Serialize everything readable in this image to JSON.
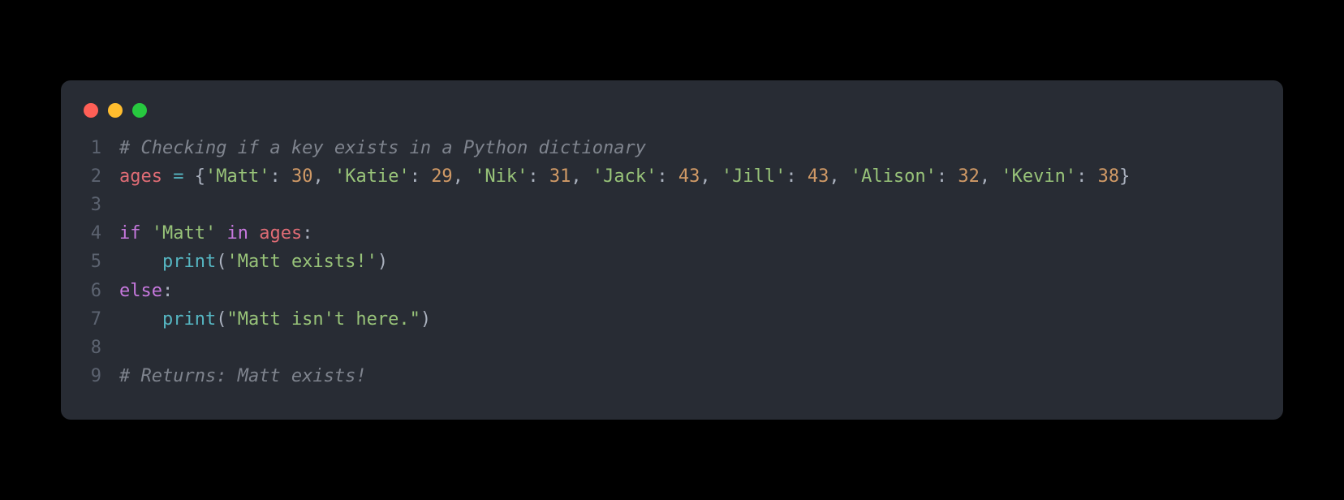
{
  "window": {
    "traffic_lights": [
      "close",
      "minimize",
      "zoom"
    ]
  },
  "code": {
    "lines": [
      {
        "n": "1",
        "tokens": [
          {
            "cls": "tok-comment",
            "t": "# Checking if a key exists in a Python dictionary"
          }
        ]
      },
      {
        "n": "2",
        "tokens": [
          {
            "cls": "tok-ident",
            "t": "ages"
          },
          {
            "cls": "tok-default",
            "t": " "
          },
          {
            "cls": "tok-op",
            "t": "="
          },
          {
            "cls": "tok-default",
            "t": " {"
          },
          {
            "cls": "tok-string",
            "t": "'Matt'"
          },
          {
            "cls": "tok-default",
            "t": ": "
          },
          {
            "cls": "tok-number",
            "t": "30"
          },
          {
            "cls": "tok-default",
            "t": ", "
          },
          {
            "cls": "tok-string",
            "t": "'Katie'"
          },
          {
            "cls": "tok-default",
            "t": ": "
          },
          {
            "cls": "tok-number",
            "t": "29"
          },
          {
            "cls": "tok-default",
            "t": ", "
          },
          {
            "cls": "tok-string",
            "t": "'Nik'"
          },
          {
            "cls": "tok-default",
            "t": ": "
          },
          {
            "cls": "tok-number",
            "t": "31"
          },
          {
            "cls": "tok-default",
            "t": ", "
          },
          {
            "cls": "tok-string",
            "t": "'Jack'"
          },
          {
            "cls": "tok-default",
            "t": ": "
          },
          {
            "cls": "tok-number",
            "t": "43"
          },
          {
            "cls": "tok-default",
            "t": ", "
          },
          {
            "cls": "tok-string",
            "t": "'Jill'"
          },
          {
            "cls": "tok-default",
            "t": ": "
          },
          {
            "cls": "tok-number",
            "t": "43"
          },
          {
            "cls": "tok-default",
            "t": ", "
          },
          {
            "cls": "tok-string",
            "t": "'Alison'"
          },
          {
            "cls": "tok-default",
            "t": ": "
          },
          {
            "cls": "tok-number",
            "t": "32"
          },
          {
            "cls": "tok-default",
            "t": ", "
          },
          {
            "cls": "tok-string",
            "t": "'Kevin'"
          },
          {
            "cls": "tok-default",
            "t": ": "
          },
          {
            "cls": "tok-number",
            "t": "38"
          },
          {
            "cls": "tok-default",
            "t": "}"
          }
        ]
      },
      {
        "n": "3",
        "tokens": []
      },
      {
        "n": "4",
        "tokens": [
          {
            "cls": "tok-keyword",
            "t": "if"
          },
          {
            "cls": "tok-default",
            "t": " "
          },
          {
            "cls": "tok-string",
            "t": "'Matt'"
          },
          {
            "cls": "tok-default",
            "t": " "
          },
          {
            "cls": "tok-keyword",
            "t": "in"
          },
          {
            "cls": "tok-default",
            "t": " "
          },
          {
            "cls": "tok-ident",
            "t": "ages"
          },
          {
            "cls": "tok-default",
            "t": ":"
          }
        ]
      },
      {
        "n": "5",
        "tokens": [
          {
            "cls": "tok-default",
            "t": "    "
          },
          {
            "cls": "tok-builtin",
            "t": "print"
          },
          {
            "cls": "tok-default",
            "t": "("
          },
          {
            "cls": "tok-string",
            "t": "'Matt exists!'"
          },
          {
            "cls": "tok-default",
            "t": ")"
          }
        ]
      },
      {
        "n": "6",
        "tokens": [
          {
            "cls": "tok-keyword",
            "t": "else"
          },
          {
            "cls": "tok-default",
            "t": ":"
          }
        ]
      },
      {
        "n": "7",
        "tokens": [
          {
            "cls": "tok-default",
            "t": "    "
          },
          {
            "cls": "tok-builtin",
            "t": "print"
          },
          {
            "cls": "tok-default",
            "t": "("
          },
          {
            "cls": "tok-string",
            "t": "\"Matt isn't here.\""
          },
          {
            "cls": "tok-default",
            "t": ")"
          }
        ]
      },
      {
        "n": "8",
        "tokens": []
      },
      {
        "n": "9",
        "tokens": [
          {
            "cls": "tok-comment",
            "t": "# Returns: Matt exists!"
          }
        ]
      }
    ]
  }
}
